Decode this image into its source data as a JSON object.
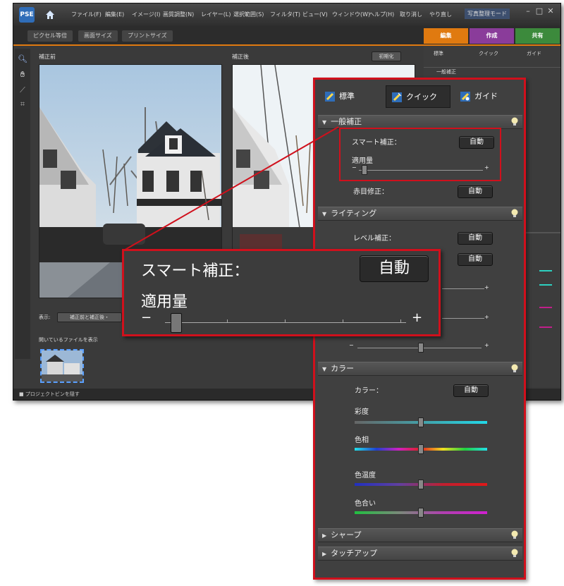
{
  "menubar": {
    "logo_text": "PSE",
    "items": [
      "ファイル(F)",
      "編集(E)",
      "イメージ(I)",
      "画質調整(N)",
      "レイヤー(L)",
      "選択範囲(S)",
      "フィルタ(T)",
      "ビュー(V)",
      "ウィンドウ(W)",
      "ヘルプ(H)",
      "取り消し",
      "やり直し",
      "写真整理モード"
    ]
  },
  "toolbar": {
    "buttons": [
      "ピクセル等倍",
      "画面サイズ",
      "プリントサイズ"
    ]
  },
  "mode_tabs": [
    {
      "label": "編集",
      "color": "#e07a10"
    },
    {
      "label": "作成",
      "color": "#8a3c9a"
    },
    {
      "label": "共有",
      "color": "#3c8a3c"
    }
  ],
  "main": {
    "before_label": "補正前",
    "after_label": "補正後",
    "reset_button": "初期化",
    "view_label": "表示:",
    "view_select": "補正前と補正後・",
    "bin_label": "開いているファイルを表示",
    "footer_text": "■ プロジェクトビンを隠す"
  },
  "panel": {
    "tabs": [
      "標準",
      "クイック",
      "ガイド"
    ],
    "sections": {
      "general": "一般補正",
      "lighting": "ライティング",
      "color": "カラー",
      "sharpen": "シャープ",
      "touchup": "タッチアップ"
    },
    "smart_fix_label": "スマート補正：",
    "amount_label": "適用量",
    "auto_label": "自動",
    "redeye_label": "赤目修正：",
    "levels_label": "レベル補正：",
    "color_label": "カラー：",
    "saturation_label": "彩度",
    "hue_label": "色相",
    "temperature_label": "色温度",
    "tint_label": "色合い",
    "minus": "−",
    "plus": "+"
  },
  "ghost": {
    "tabs": [
      "標準",
      "クイック",
      "ガイド"
    ],
    "section": "一般補正"
  },
  "zoom": {
    "smart_fix_label": "スマート補正：",
    "auto_label": "自動",
    "amount_label": "適用量",
    "minus": "−",
    "plus": "+"
  },
  "colors": {
    "accent_red": "#d0101c",
    "edit_orange": "#e07a10"
  }
}
